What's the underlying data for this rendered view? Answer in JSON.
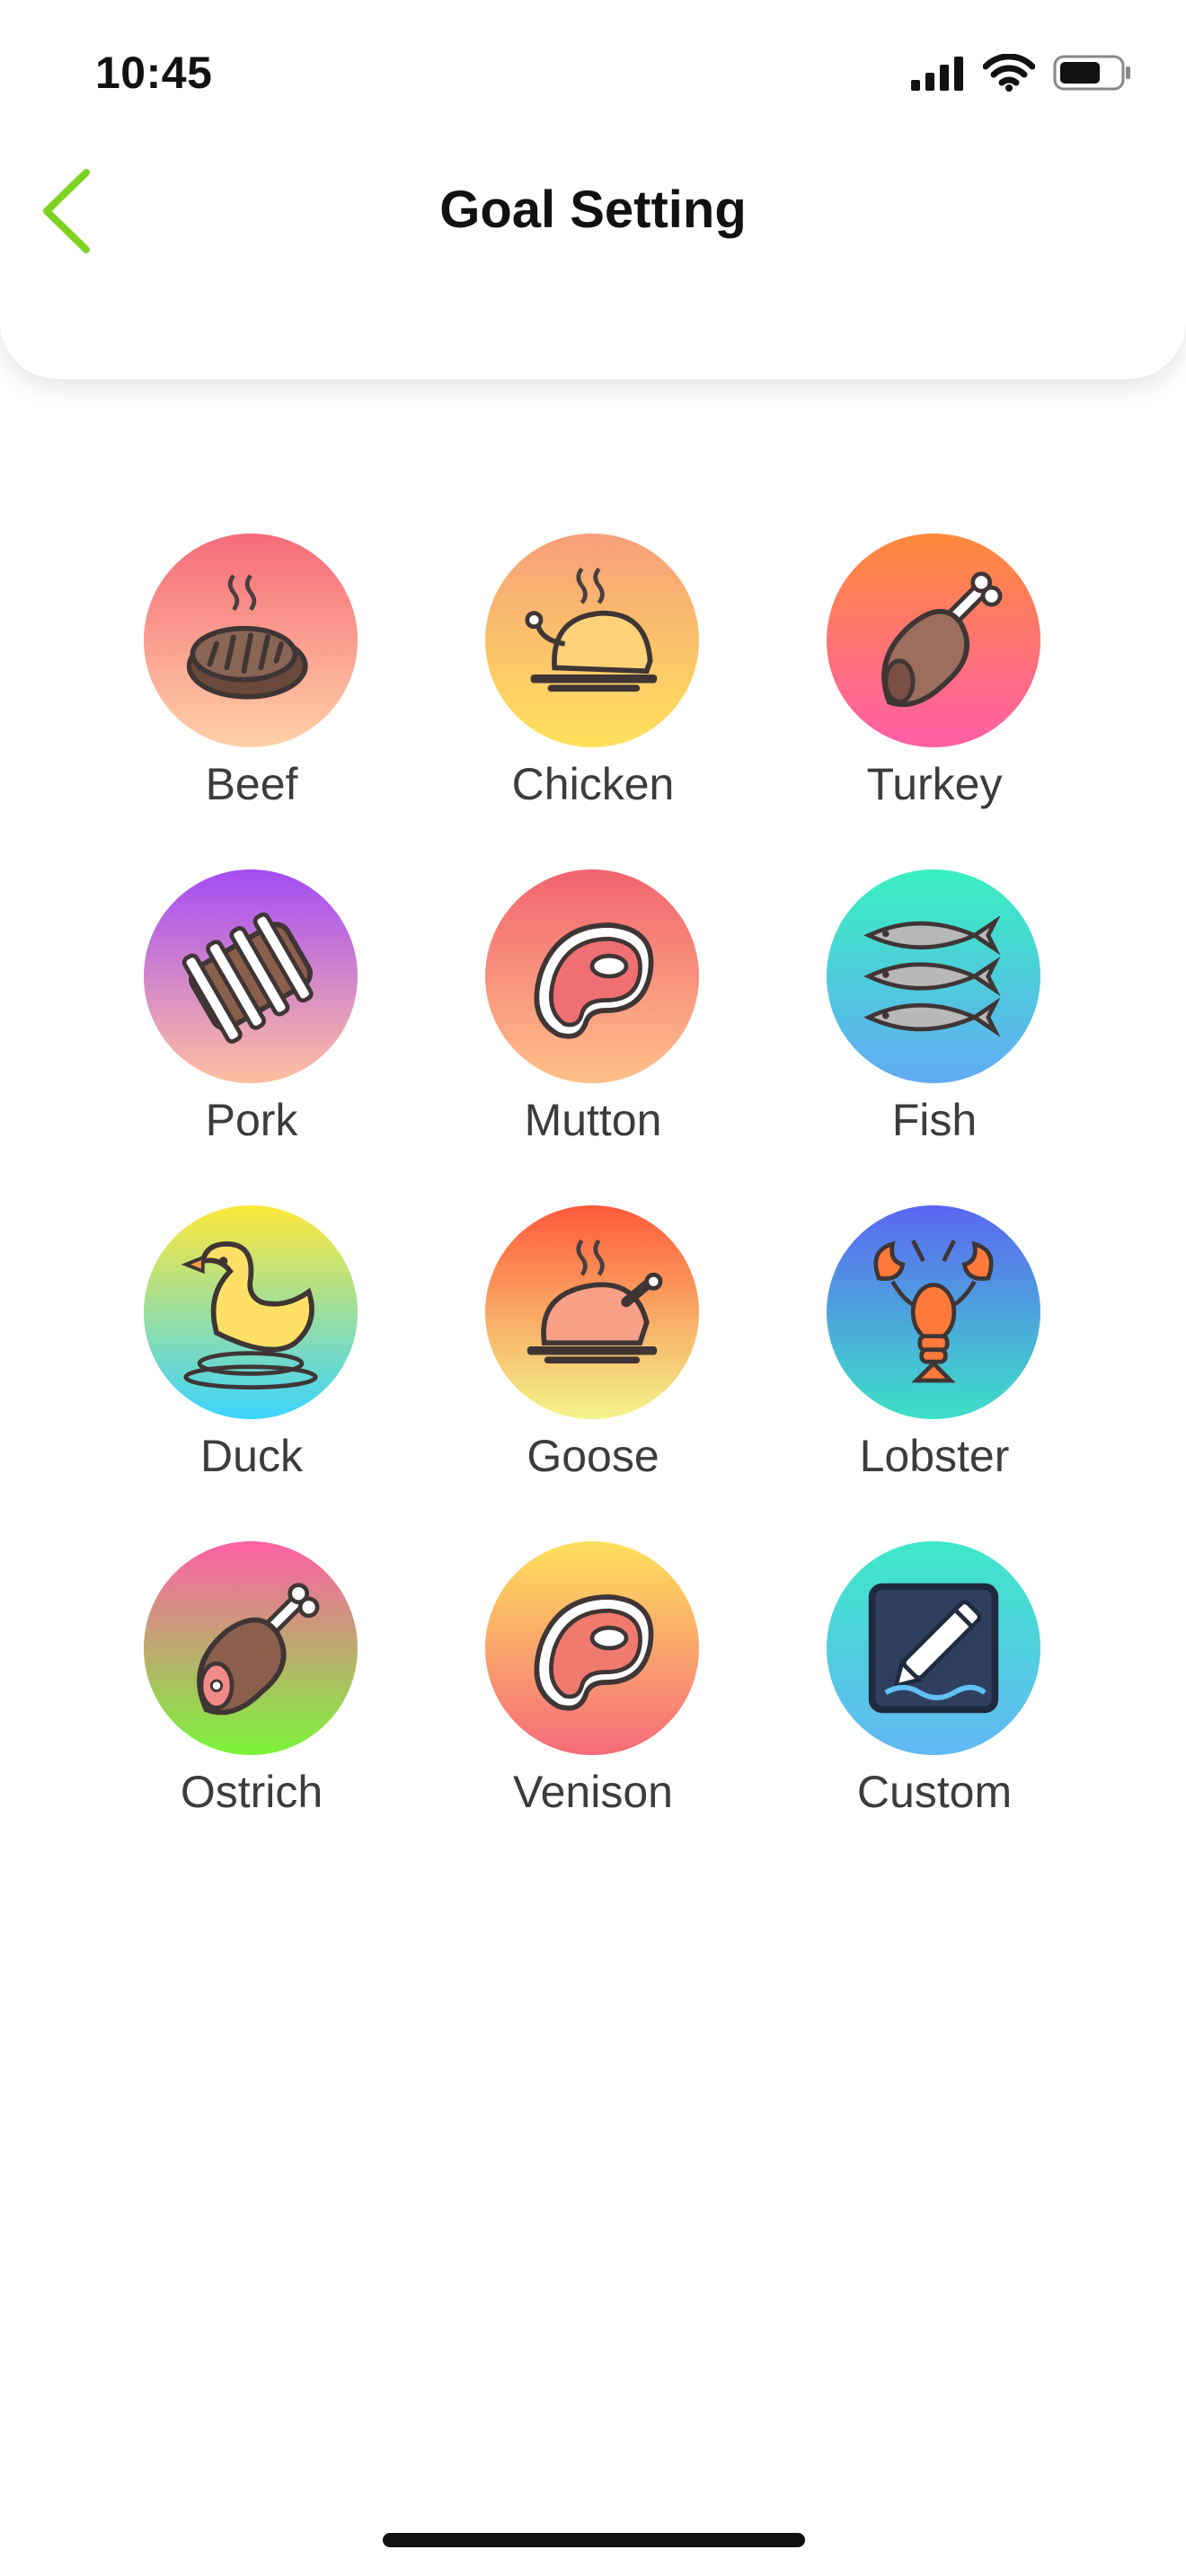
{
  "status_bar": {
    "time": "10:45"
  },
  "nav": {
    "title": "Goal Setting",
    "back_icon": "chevron-left-icon",
    "accent": "#7ed321"
  },
  "categories": [
    {
      "label": "Beef",
      "icon": "steak-icon"
    },
    {
      "label": "Chicken",
      "icon": "roast-chicken-icon"
    },
    {
      "label": "Turkey",
      "icon": "drumstick-icon"
    },
    {
      "label": "Pork",
      "icon": "ribs-icon"
    },
    {
      "label": "Mutton",
      "icon": "meat-cut-icon"
    },
    {
      "label": "Fish",
      "icon": "fish-icon"
    },
    {
      "label": "Duck",
      "icon": "duck-icon"
    },
    {
      "label": "Goose",
      "icon": "roast-goose-icon"
    },
    {
      "label": "Lobster",
      "icon": "lobster-icon"
    },
    {
      "label": "Ostrich",
      "icon": "ham-leg-icon"
    },
    {
      "label": "Venison",
      "icon": "meat-cut-icon"
    },
    {
      "label": "Custom",
      "icon": "edit-pencil-icon"
    }
  ]
}
